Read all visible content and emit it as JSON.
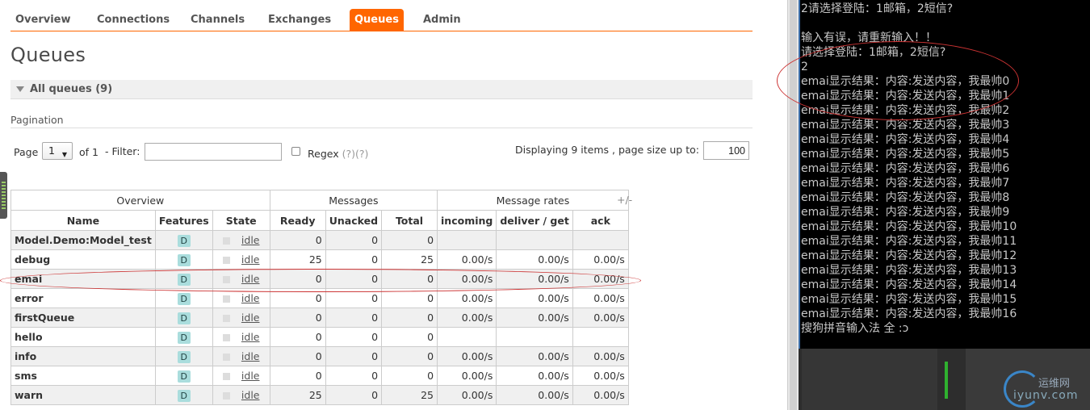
{
  "nav": {
    "items": [
      {
        "label": "Overview",
        "active": false
      },
      {
        "label": "Connections",
        "active": false
      },
      {
        "label": "Channels",
        "active": false
      },
      {
        "label": "Exchanges",
        "active": false
      },
      {
        "label": "Queues",
        "active": true
      },
      {
        "label": "Admin",
        "active": false
      }
    ]
  },
  "page": {
    "title": "Queues",
    "section_label": "All queues (9)"
  },
  "pagination": {
    "label": "Pagination",
    "page_label": "Page",
    "page_value": "1",
    "of_label": "of 1",
    "filter_label": "- Filter:",
    "filter_value": "",
    "regex_label": "Regex",
    "regex_help": "(?)(?)",
    "displaying_text": "Displaying 9 items , page size up to:",
    "page_size": "100"
  },
  "table": {
    "groups": [
      "Overview",
      "Messages",
      "Message rates"
    ],
    "columns": [
      "Name",
      "Features",
      "State",
      "Ready",
      "Unacked",
      "Total",
      "incoming",
      "deliver / get",
      "ack"
    ],
    "plus_minus": "+/-",
    "rows": [
      {
        "name": "Model.Demo:Model_test",
        "feature": "D",
        "state": "idle",
        "ready": "0",
        "unacked": "0",
        "total": "0",
        "incoming": "",
        "deliver": "",
        "ack": ""
      },
      {
        "name": "debug",
        "feature": "D",
        "state": "idle",
        "ready": "25",
        "unacked": "0",
        "total": "25",
        "incoming": "0.00/s",
        "deliver": "0.00/s",
        "ack": "0.00/s"
      },
      {
        "name": "emai",
        "feature": "D",
        "state": "idle",
        "ready": "0",
        "unacked": "0",
        "total": "0",
        "incoming": "0.00/s",
        "deliver": "0.00/s",
        "ack": "0.00/s"
      },
      {
        "name": "error",
        "feature": "D",
        "state": "idle",
        "ready": "0",
        "unacked": "0",
        "total": "0",
        "incoming": "0.00/s",
        "deliver": "0.00/s",
        "ack": "0.00/s"
      },
      {
        "name": "firstQueue",
        "feature": "D",
        "state": "idle",
        "ready": "0",
        "unacked": "0",
        "total": "0",
        "incoming": "0.00/s",
        "deliver": "0.00/s",
        "ack": "0.00/s"
      },
      {
        "name": "hello",
        "feature": "D",
        "state": "idle",
        "ready": "0",
        "unacked": "0",
        "total": "0",
        "incoming": "",
        "deliver": "",
        "ack": ""
      },
      {
        "name": "info",
        "feature": "D",
        "state": "idle",
        "ready": "0",
        "unacked": "0",
        "total": "0",
        "incoming": "0.00/s",
        "deliver": "0.00/s",
        "ack": "0.00/s"
      },
      {
        "name": "sms",
        "feature": "D",
        "state": "idle",
        "ready": "0",
        "unacked": "0",
        "total": "0",
        "incoming": "0.00/s",
        "deliver": "0.00/s",
        "ack": "0.00/s"
      },
      {
        "name": "warn",
        "feature": "D",
        "state": "idle",
        "ready": "25",
        "unacked": "0",
        "total": "25",
        "incoming": "0.00/s",
        "deliver": "0.00/s",
        "ack": "0.00/s"
      }
    ]
  },
  "console": {
    "lines": [
      "2请选择登陆：1邮箱，2短信?",
      "",
      "输入有误，请重新输入！！",
      "请选择登陆：1邮箱，2短信?",
      "2",
      "emai显示结果：内容:发送内容，我最帅0",
      "emai显示结果：内容:发送内容，我最帅1",
      "emai显示结果：内容:发送内容，我最帅2",
      "emai显示结果：内容:发送内容，我最帅3",
      "emai显示结果：内容:发送内容，我最帅4",
      "emai显示结果：内容:发送内容，我最帅5",
      "emai显示结果：内容:发送内容，我最帅6",
      "emai显示结果：内容:发送内容，我最帅7",
      "emai显示结果：内容:发送内容，我最帅8",
      "emai显示结果：内容:发送内容，我最帅9",
      "emai显示结果：内容:发送内容，我最帅10",
      "emai显示结果：内容:发送内容，我最帅11",
      "emai显示结果：内容:发送内容，我最帅12",
      "emai显示结果：内容:发送内容，我最帅13",
      "emai显示结果：内容:发送内容，我最帅14",
      "emai显示结果：内容:发送内容，我最帅15",
      "emai显示结果：内容:发送内容，我最帅16",
      "搜狗拼音输入法 全 :ɔ"
    ]
  },
  "watermark": {
    "site_name": "运维网",
    "site_url": "iyunv.com"
  },
  "colors": {
    "accent": "#ff6600",
    "feature_badge": "#aadddd",
    "console_bg": "#000000",
    "annotation": "#cc3333"
  }
}
